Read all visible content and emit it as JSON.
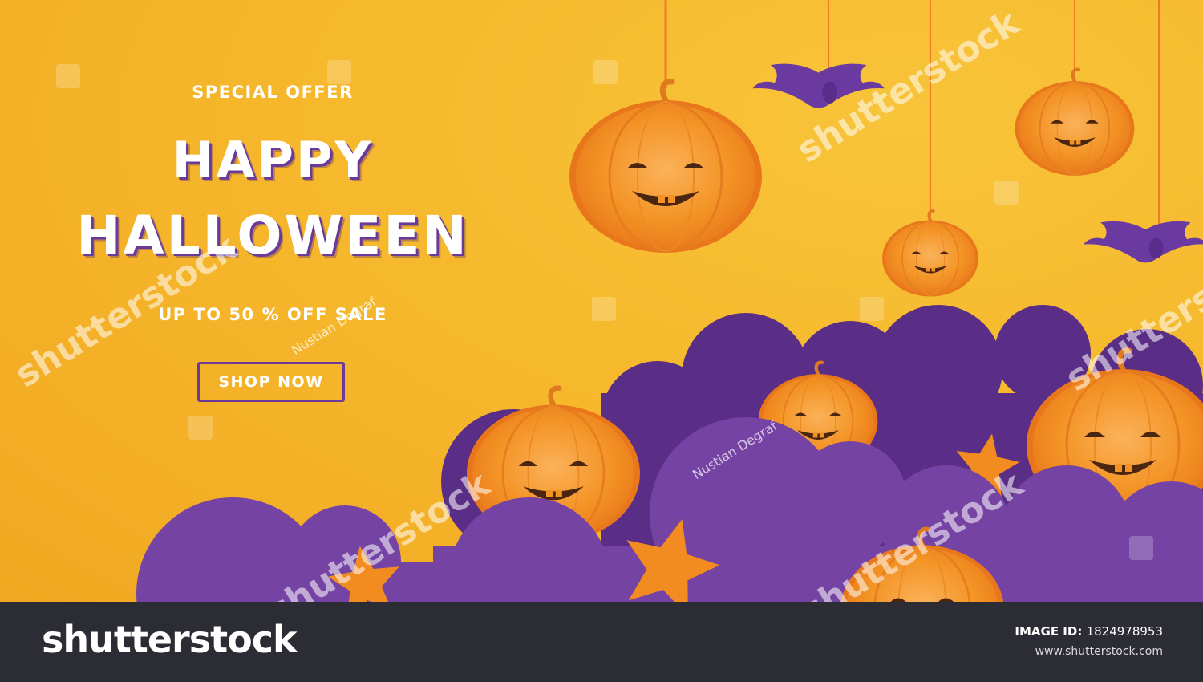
{
  "banner": {
    "special_offer": "SPECIAL OFFER",
    "title_line1": "HAPPY",
    "title_line2": "HALLOWEEN",
    "sale_text": "UP TO 50 % OFF SALE",
    "cta_label": "SHOP NOW"
  },
  "colors": {
    "background": "#f5b62a",
    "pumpkin": "#f08a1c",
    "cloud_purple": "#6f3f9e",
    "cloud_dark": "#5a2d86",
    "footer": "#2c2c34"
  },
  "watermark": {
    "brand": "shutterstock",
    "contributor": "Nustian Degraf"
  },
  "footer": {
    "logo": "shutterstock",
    "image_id_label": "IMAGE ID:",
    "image_id": "1824978953",
    "site": "www.shutterstock.com"
  }
}
